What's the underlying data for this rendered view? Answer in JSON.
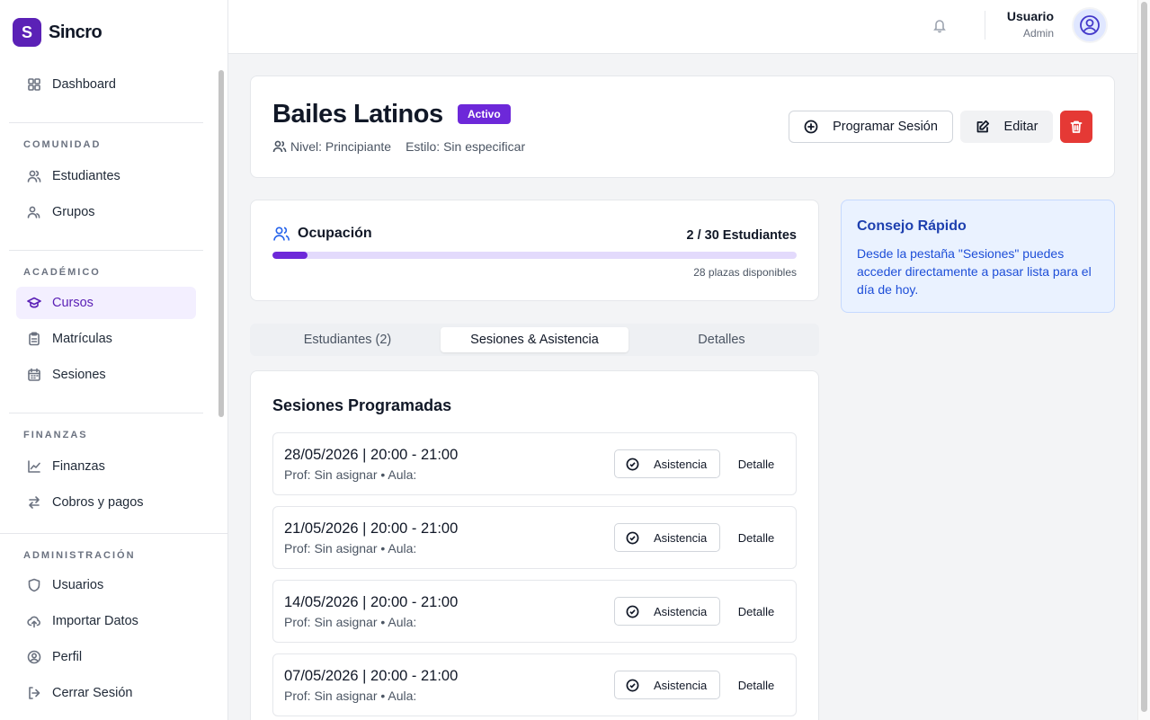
{
  "brand": {
    "logo_letter": "S",
    "name": "Sincro"
  },
  "sidebar": {
    "dashboard": "Dashboard",
    "sections": {
      "comunidad": "COMUNIDAD",
      "academico": "ACADÉMICO",
      "finanzas": "FINANZAS",
      "administracion": "ADMINISTRACIÓN"
    },
    "items": {
      "estudiantes": "Estudiantes",
      "grupos": "Grupos",
      "cursos": "Cursos",
      "matriculas": "Matrículas",
      "sesiones": "Sesiones",
      "finanzas": "Finanzas",
      "cobros": "Cobros y pagos",
      "usuarios": "Usuarios",
      "importar": "Importar Datos",
      "perfil": "Perfil",
      "cerrar": "Cerrar Sesión"
    },
    "active": "cursos"
  },
  "topbar": {
    "user_name": "Usuario",
    "user_role": "Admin"
  },
  "course": {
    "title": "Bailes Latinos",
    "status": "Activo",
    "level": "Nivel: Principiante",
    "style": "Estilo: Sin especificar"
  },
  "actions": {
    "schedule": "Programar Sesión",
    "edit": "Editar"
  },
  "occupancy": {
    "label": "Ocupación",
    "count": "2 / 30 Estudiantes",
    "available": "28 plazas disponibles",
    "enrolled": 2,
    "capacity": 30
  },
  "tip": {
    "title": "Consejo Rápido",
    "text": "Desde la pestaña \"Sesiones\" puedes acceder directamente a pasar lista para el día de hoy."
  },
  "tabs": [
    {
      "label": "Estudiantes (2)",
      "active": false
    },
    {
      "label": "Sesiones & Asistencia",
      "active": true
    },
    {
      "label": "Detalles",
      "active": false
    }
  ],
  "sessions": {
    "title": "Sesiones Programadas",
    "attendance_label": "Asistencia",
    "detail_label": "Detalle",
    "items": [
      {
        "datetime": "28/05/2026 | 20:00 - 21:00",
        "info": "Prof: Sin asignar • Aula:"
      },
      {
        "datetime": "21/05/2026 | 20:00 - 21:00",
        "info": "Prof: Sin asignar • Aula:"
      },
      {
        "datetime": "14/05/2026 | 20:00 - 21:00",
        "info": "Prof: Sin asignar • Aula:"
      },
      {
        "datetime": "07/05/2026 | 20:00 - 21:00",
        "info": "Prof: Sin asignar • Aula:"
      }
    ]
  },
  "colors": {
    "accent": "#6d28d9",
    "danger": "#e53935",
    "info": "#1e40af"
  }
}
